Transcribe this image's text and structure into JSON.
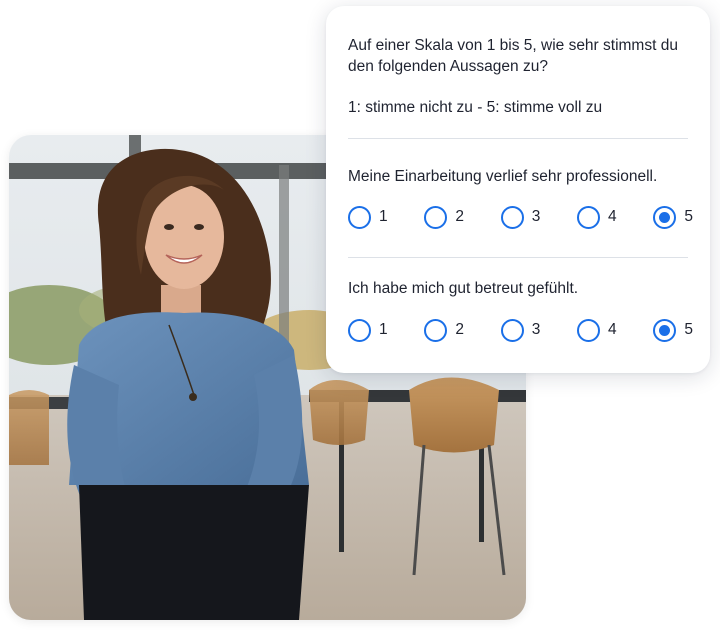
{
  "survey": {
    "intro": "Auf einer Skala von 1 bis 5, wie sehr stimmst du den folgenden Aussagen zu?",
    "scale_hint": "1: stimme nicht zu - 5: stimme voll zu",
    "questions": [
      {
        "statement": "Meine Einarbeitung verlief sehr professionell.",
        "options": [
          "1",
          "2",
          "3",
          "4",
          "5"
        ],
        "selected": "5"
      },
      {
        "statement": "Ich habe mich gut betreut gefühlt.",
        "options": [
          "1",
          "2",
          "3",
          "4",
          "5"
        ],
        "selected": "5"
      }
    ]
  },
  "colors": {
    "accent": "#1a6fe8",
    "text": "#1f2330",
    "divider": "#dde1e7"
  }
}
